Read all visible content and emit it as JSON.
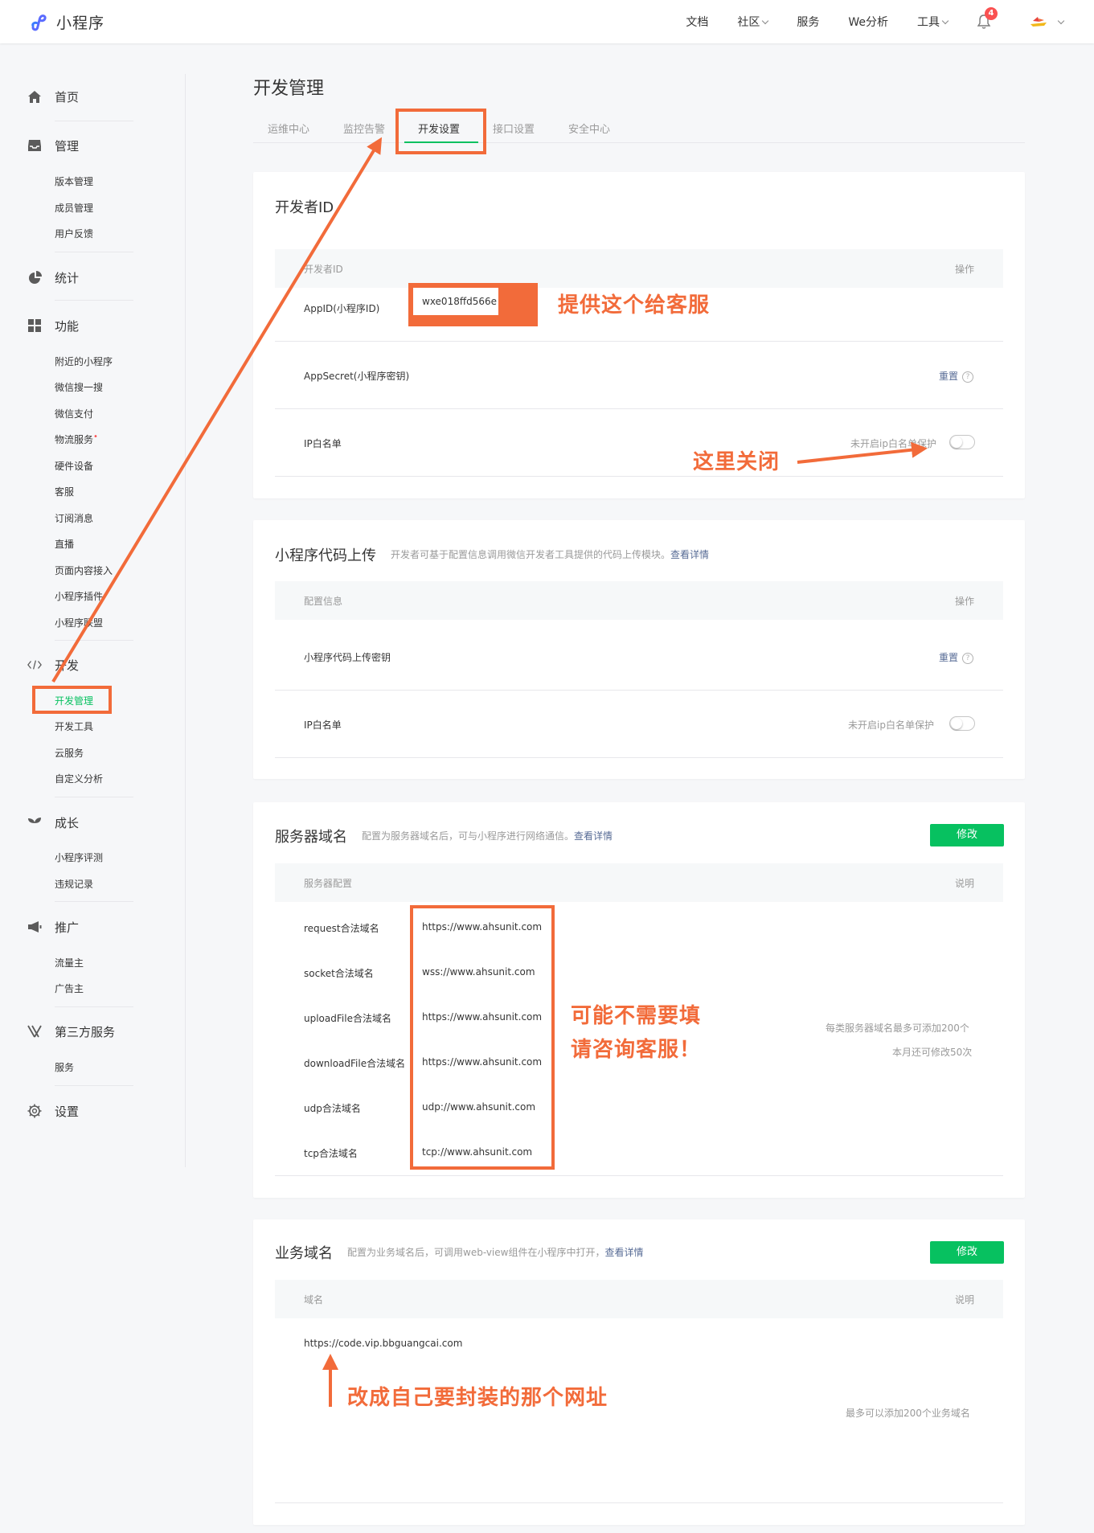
{
  "header": {
    "logo_text": "小程序",
    "nav": [
      {
        "label": "文档"
      },
      {
        "label": "社区"
      },
      {
        "label": "服务"
      },
      {
        "label": "We分析"
      },
      {
        "label": "工具"
      }
    ],
    "notification_count": "4"
  },
  "sidebar": {
    "home": "首页",
    "manage": {
      "label": "管理",
      "items": [
        "版本管理",
        "成员管理",
        "用户反馈"
      ]
    },
    "stats": "统计",
    "features": {
      "label": "功能",
      "items": [
        "附近的小程序",
        "微信搜一搜",
        "微信支付",
        "物流服务",
        "硬件设备",
        "客服",
        "订阅消息",
        "直播",
        "页面内容接入",
        "小程序插件",
        "小程序联盟"
      ]
    },
    "dev": {
      "label": "开发",
      "items": [
        "开发管理",
        "开发工具",
        "云服务",
        "自定义分析"
      ]
    },
    "growth": {
      "label": "成长",
      "items": [
        "小程序评测",
        "违规记录"
      ]
    },
    "promote": {
      "label": "推广",
      "items": [
        "流量主",
        "广告主"
      ]
    },
    "third_party": {
      "label": "第三方服务",
      "items": [
        "服务"
      ]
    },
    "settings": "设置"
  },
  "main": {
    "title": "开发管理",
    "tabs": [
      "运维中心",
      "监控告警",
      "开发设置",
      "接口设置",
      "安全中心"
    ]
  },
  "developer_id": {
    "title": "开发者ID",
    "col_left": "开发者ID",
    "col_right": "操作",
    "appid_label": "AppID(小程序ID)",
    "appid_value": "wxe018ffd566e",
    "secret_label": "AppSecret(小程序密钥)",
    "secret_action": "重置",
    "ip_label": "IP白名单",
    "ip_status": "未开启ip白名单保护"
  },
  "code_upload": {
    "title": "小程序代码上传",
    "desc": "开发者可基于配置信息调用微信开发者工具提供的代码上传模块。",
    "desc_link": "查看详情",
    "col_left": "配置信息",
    "col_right": "操作",
    "key_label": "小程序代码上传密钥",
    "key_action": "重置",
    "ip_label": "IP白名单",
    "ip_status": "未开启ip白名单保护"
  },
  "server_domain": {
    "title": "服务器域名",
    "desc": "配置为服务器域名后，可与小程序进行网络通信。",
    "desc_link": "查看详情",
    "button": "修改",
    "col_left": "服务器配置",
    "col_right": "说明",
    "rows": [
      {
        "label": "request合法域名",
        "value": "https://www.ahsunit.com"
      },
      {
        "label": "socket合法域名",
        "value": "wss://www.ahsunit.com"
      },
      {
        "label": "uploadFile合法域名",
        "value": "https://www.ahsunit.com"
      },
      {
        "label": "downloadFile合法域名",
        "value": "https://www.ahsunit.com"
      },
      {
        "label": "udp合法域名",
        "value": "udp://www.ahsunit.com"
      },
      {
        "label": "tcp合法域名",
        "value": "tcp://www.ahsunit.com"
      }
    ],
    "note_1": "每类服务器域名最多可添加200个",
    "note_2": "本月还可修改50次"
  },
  "business_domain": {
    "title": "业务域名",
    "desc": "配置为业务域名后，可调用web-view组件在小程序中打开，",
    "desc_link": "查看详情",
    "button": "修改",
    "col_left": "域名",
    "col_right": "说明",
    "value": "https://code.vip.bbguangcai.com",
    "note": "最多可以添加200个业务域名"
  },
  "annotations": {
    "appid": "提供这个给客服",
    "ip_close": "这里关闭",
    "server_line1": "可能不需要填",
    "server_line2": "请咨询客服！",
    "business": "改成自己要封装的那个网址",
    "color": "#f26b3a"
  }
}
